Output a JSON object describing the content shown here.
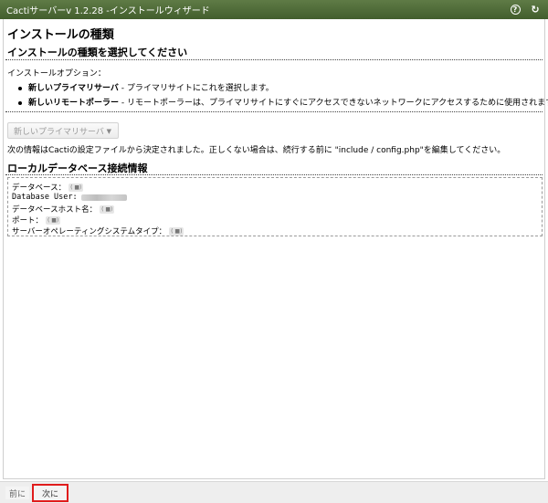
{
  "titlebar": {
    "title": "Cactiサーバーv 1.2.28 -インストールウィザード",
    "help_icon_glyph": "?",
    "refresh_icon_glyph": "↻",
    "color_bar": "#4f6b39"
  },
  "main": {
    "heading": "インストールの種類",
    "subheading": "インストールの種類を選択してください",
    "options_label": "インストールオプション：",
    "options": [
      {
        "name": "新しいプライマリサーバ",
        "desc": " - プライマリサイトにこれを選択します。"
      },
      {
        "name": "新しいリモートポーラー",
        "desc": " - リモートポーラーは、プライマリサイトにすぐにアクセスできないネットワークにアクセスするために使用されます。"
      }
    ],
    "select_value": "新しいプライマリサーバ",
    "info_text": "次の情報はCactiの設定ファイルから決定されました。正しくない場合は、続行する前に \"include / config.php\"を編集してください。",
    "db_heading": "ローカルデータベース接続情報",
    "db_rows": [
      {
        "label": "データベース：",
        "value": "( ■)"
      },
      {
        "label": "Database User:",
        "value": ""
      },
      {
        "label": "データベースホスト名：",
        "value": "( ■)"
      },
      {
        "label": "ポート：",
        "value": "( ■)"
      },
      {
        "label": "サーバーオペレーティングシステムタイプ：",
        "value": "( ■)"
      }
    ]
  },
  "footer": {
    "prev_label": "前に",
    "next_label": "次に",
    "highlight_color": "#e01c1c"
  }
}
